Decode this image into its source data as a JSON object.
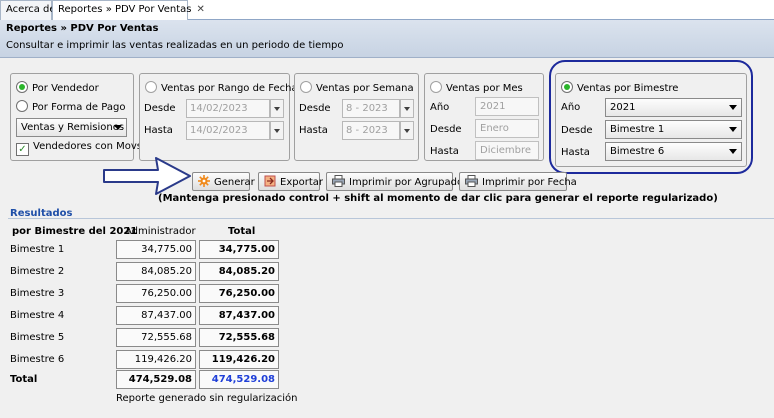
{
  "tabs": [
    {
      "label": "Acerca de"
    },
    {
      "label": "Reportes » PDV Por Ventas",
      "close": "✕"
    }
  ],
  "header": {
    "title": "Reportes » PDV Por Ventas",
    "subtitle": "Consultar e imprimir las ventas realizadas en un periodo de tiempo"
  },
  "group_vendedor": {
    "opt_vendedor": "Por Vendedor",
    "opt_forma_pago": "Por Forma de Pago",
    "select_value": "Ventas y Remisiones",
    "check_label": "Vendedores con Movs",
    "check_mark": "✓"
  },
  "group_fechas": {
    "title": "Ventas por Rango de Fechas",
    "desde_label": "Desde",
    "desde_value": "14/02/2023",
    "hasta_label": "Hasta",
    "hasta_value": "14/02/2023"
  },
  "group_semana": {
    "title": "Ventas por Semana",
    "desde_label": "Desde",
    "desde_value": "8 - 2023",
    "hasta_label": "Hasta",
    "hasta_value": "8 - 2023"
  },
  "group_mes": {
    "title": "Ventas por Mes",
    "anio_label": "Año",
    "anio_value": "2021",
    "desde_label": "Desde",
    "desde_value": "Enero",
    "hasta_label": "Hasta",
    "hasta_value": "Diciembre"
  },
  "group_bimestre": {
    "title": "Ventas por Bimestre",
    "anio_label": "Año",
    "anio_value": "2021",
    "desde_label": "Desde",
    "desde_value": "Bimestre 1",
    "hasta_label": "Hasta",
    "hasta_value": "Bimestre 6"
  },
  "toolbar": {
    "generar": "Generar",
    "exportar": "Exportar",
    "imprimir_agrupador": "Imprimir por Agrupador",
    "imprimir_fecha": "Imprimir por Fecha",
    "note": "(Mantenga presionado control + shift al momento de dar clic para generar el reporte regularizado)"
  },
  "results": {
    "label": "Resultados",
    "col_period": "por Bimestre del 2021",
    "col_admin": "Administrador",
    "col_total": "Total",
    "rows": [
      {
        "name": "Bimestre 1",
        "admin": "34,775.00",
        "total": "34,775.00"
      },
      {
        "name": "Bimestre 2",
        "admin": "84,085.20",
        "total": "84,085.20"
      },
      {
        "name": "Bimestre 3",
        "admin": "76,250.00",
        "total": "76,250.00"
      },
      {
        "name": "Bimestre 4",
        "admin": "87,437.00",
        "total": "87,437.00"
      },
      {
        "name": "Bimestre 5",
        "admin": "72,555.68",
        "total": "72,555.68"
      },
      {
        "name": "Bimestre 6",
        "admin": "119,426.20",
        "total": "119,426.20"
      }
    ],
    "total_label": "Total",
    "total_admin": "474,529.08",
    "total_total": "474,529.08",
    "footer": "Reporte generado sin regularización"
  },
  "colors": {
    "accent": "#1f3fd8",
    "highlight": "#1d2a9c",
    "radio_selected": "#2bb52b"
  }
}
